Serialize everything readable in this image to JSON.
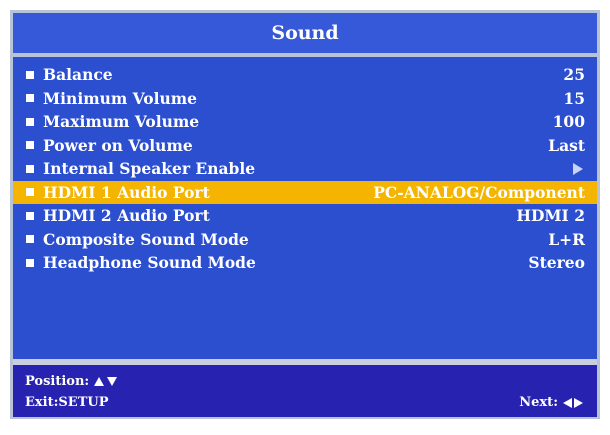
{
  "title": "Sound",
  "colors": {
    "title_bg": "#3559d8",
    "menu_bg": "#2c4fd0",
    "selected_bg": "#f5b400",
    "footer_bg": "#2723b0",
    "frame": "#b8c3d6"
  },
  "menu": {
    "selected_index": 5,
    "items": [
      {
        "label": "Balance",
        "value": "25"
      },
      {
        "label": "Minimum Volume",
        "value": "15"
      },
      {
        "label": "Maximum Volume",
        "value": "100"
      },
      {
        "label": "Power on Volume",
        "value": "Last"
      },
      {
        "label": "Internal Speaker Enable",
        "value": "",
        "icon": "arrow-right-icon"
      },
      {
        "label": "HDMI 1 Audio Port",
        "value": "PC-ANALOG/Component"
      },
      {
        "label": "HDMI 2 Audio Port",
        "value": "HDMI 2"
      },
      {
        "label": "Composite Sound Mode",
        "value": "L+R"
      },
      {
        "label": "Headphone Sound Mode",
        "value": "Stereo"
      }
    ]
  },
  "footer": {
    "position_label": "Position:",
    "exit_label": "Exit:SETUP",
    "next_label": "Next:"
  }
}
